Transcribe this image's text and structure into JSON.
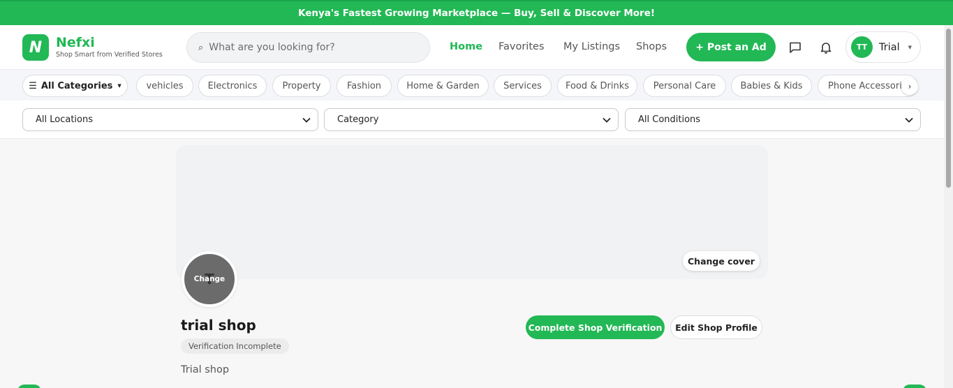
{
  "banner": {
    "text": "Kenya's Fastest Growing Marketplace — Buy, Sell & Discover More!"
  },
  "brand": {
    "logo_letter": "N",
    "name": "Nefxi",
    "tagline": "Shop Smart from Verified Stores",
    "accent": "#22b855"
  },
  "search": {
    "placeholder": "What are you looking for?"
  },
  "nav": {
    "home": "Home",
    "favorites": "Favorites",
    "my_listings": "My Listings",
    "shops": "Shops",
    "active": "Home"
  },
  "post_button": "+ Post an Ad",
  "user": {
    "initials": "TT",
    "name": "Trial"
  },
  "categories": {
    "all_label": "All Categories",
    "items": [
      "vehicles",
      "Electronics",
      "Property",
      "Fashion",
      "Home & Garden",
      "Services",
      "Food & Drinks",
      "Personal Care",
      "Babies & Kids",
      "Phone Accessories"
    ],
    "next_arrow": "›"
  },
  "filters": {
    "location": "All Locations",
    "category": "Category",
    "condition": "All Conditions"
  },
  "shop": {
    "change_cover": "Change cover",
    "avatar_letter": "T",
    "avatar_change": "Change",
    "name": "trial shop",
    "status": "Verification Incomplete",
    "description": "Trial shop",
    "verify_button": "Complete Shop Verification",
    "edit_button": "Edit Shop Profile"
  }
}
